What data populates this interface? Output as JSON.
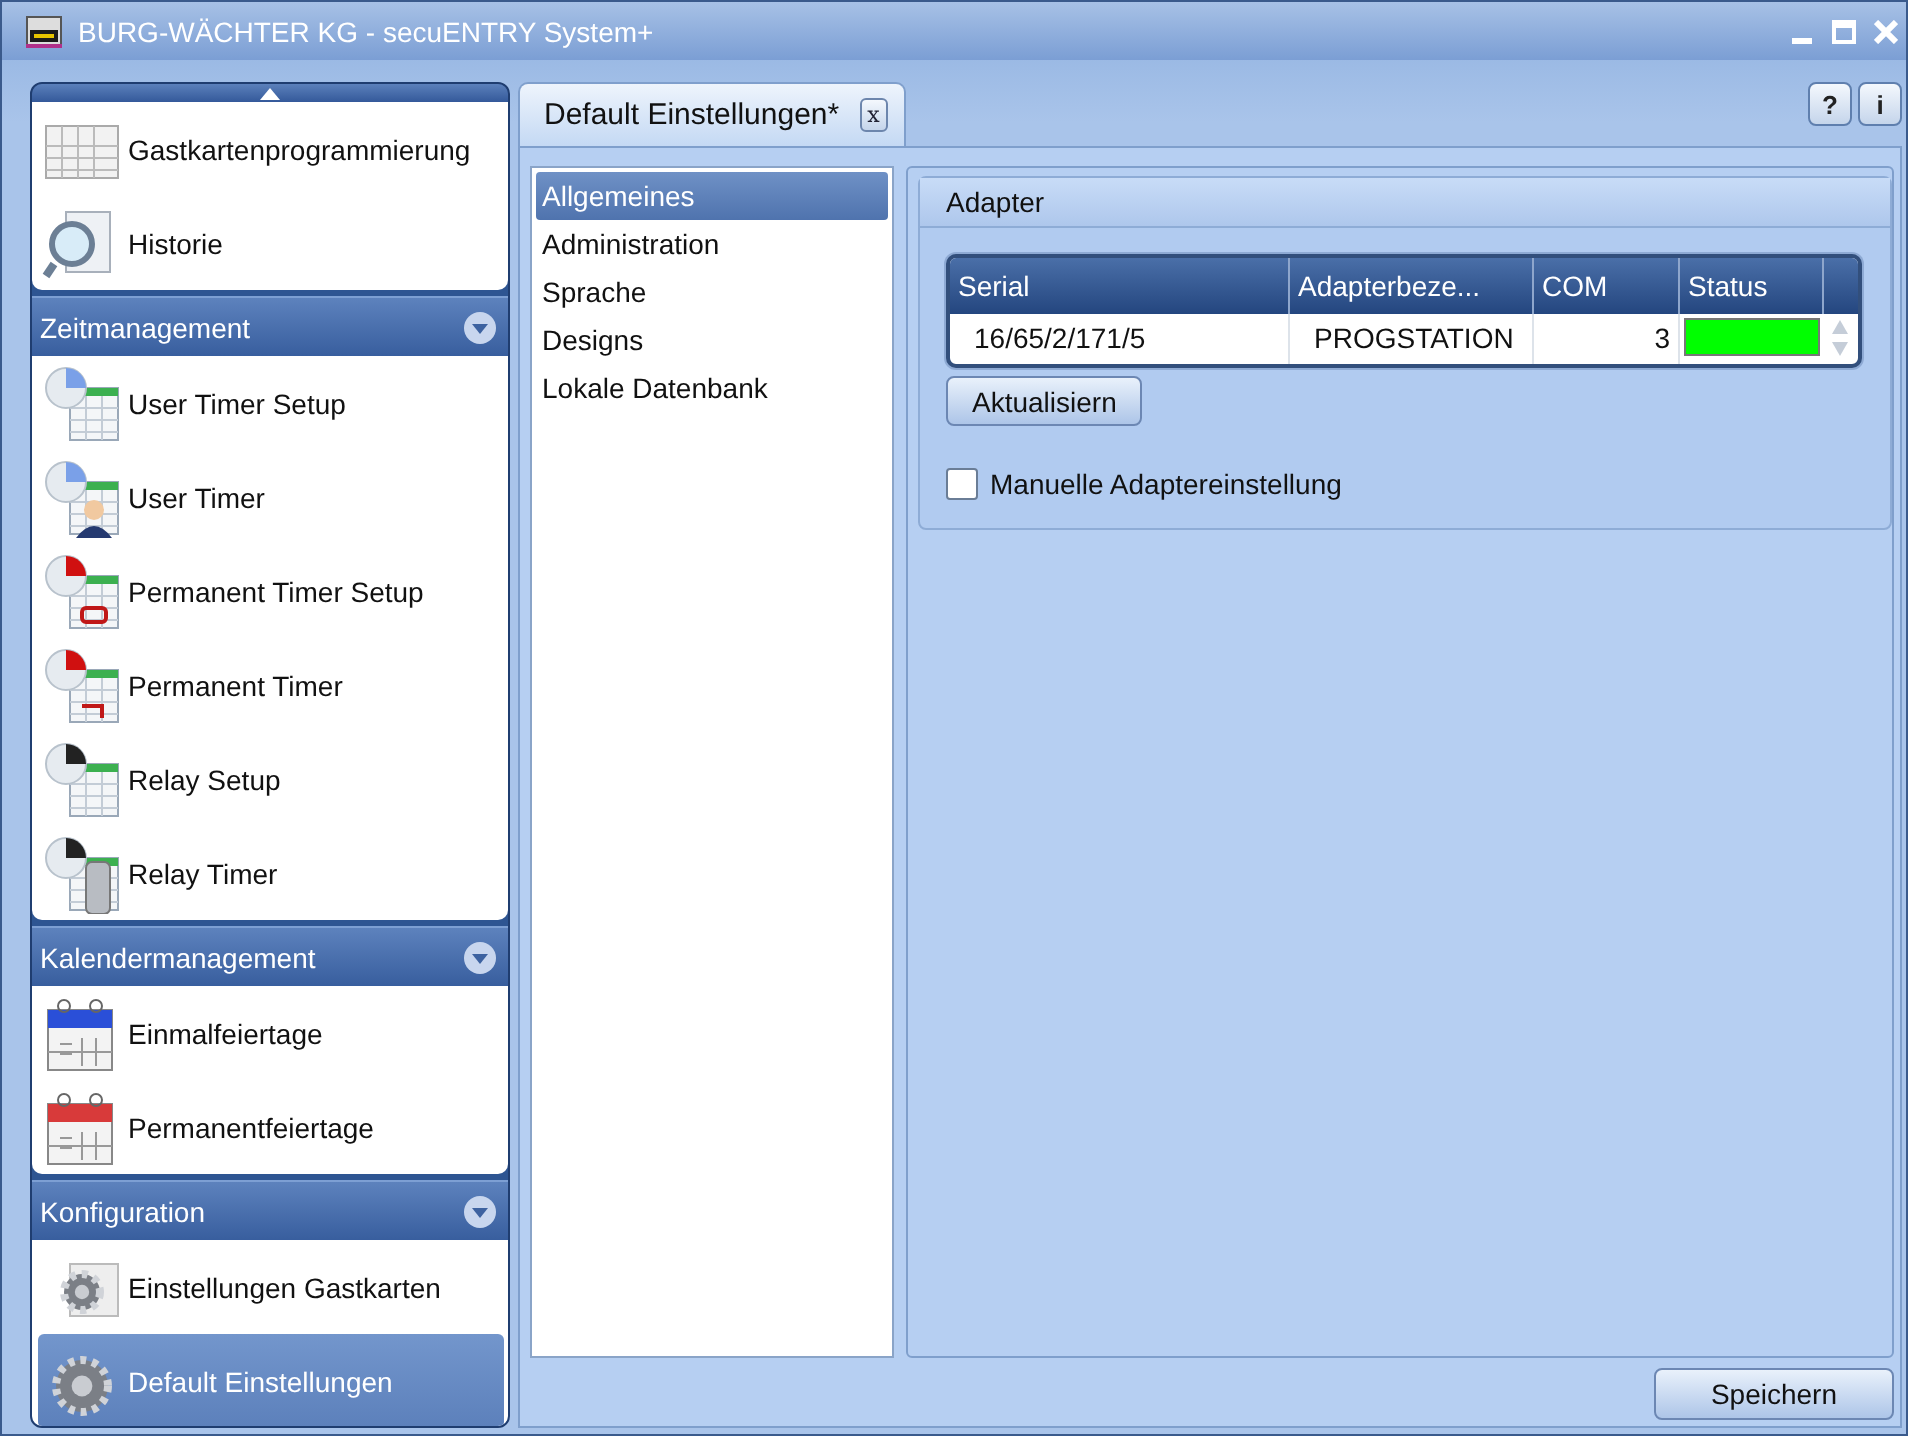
{
  "window": {
    "title": "BURG-WÄCHTER KG - secuENTRY System+"
  },
  "sidebar": {
    "groups": [
      {
        "items": [
          {
            "label": "Gastkartenprogrammierung",
            "kind": "guest-card",
            "selected": false
          },
          {
            "label": "Historie",
            "kind": "history",
            "selected": false
          }
        ]
      },
      {
        "title": "Zeitmanagement",
        "items": [
          {
            "label": "User Timer Setup",
            "kind": "user-timer-setup",
            "selected": false
          },
          {
            "label": "User Timer",
            "kind": "user-timer",
            "selected": false
          },
          {
            "label": "Permanent Timer Setup",
            "kind": "permanent-timer-setup",
            "selected": false
          },
          {
            "label": "Permanent Timer",
            "kind": "permanent-timer",
            "selected": false
          },
          {
            "label": "Relay Setup",
            "kind": "relay-setup",
            "selected": false
          },
          {
            "label": "Relay Timer",
            "kind": "relay-timer",
            "selected": false
          }
        ]
      },
      {
        "title": "Kalendermanagement",
        "items": [
          {
            "label": "Einmalfeiertage",
            "kind": "single-holiday",
            "selected": false
          },
          {
            "label": "Permanentfeiertage",
            "kind": "permanent-holiday",
            "selected": false
          }
        ]
      },
      {
        "title": "Konfiguration",
        "items": [
          {
            "label": "Einstellungen Gastkarten",
            "kind": "guest-card-settings",
            "selected": false
          },
          {
            "label": "Default Einstellungen",
            "kind": "default-settings",
            "selected": true
          }
        ]
      }
    ]
  },
  "tabs": [
    {
      "label": "Default Einstellungen*",
      "close": "x",
      "selected": true
    }
  ],
  "help_buttons": [
    "?",
    "i"
  ],
  "settings_list": [
    {
      "label": "Allgemeines",
      "selected": true
    },
    {
      "label": "Administration",
      "selected": false
    },
    {
      "label": "Sprache",
      "selected": false
    },
    {
      "label": "Designs",
      "selected": false
    },
    {
      "label": "Lokale Datenbank",
      "selected": false
    }
  ],
  "adapter": {
    "title": "Adapter",
    "table": {
      "columns": [
        "Serial",
        "Adapterbeze...",
        "COM",
        "Status"
      ],
      "rows": [
        {
          "serial": "16/65/2/171/5",
          "name": "PROGSTATION",
          "com": "3",
          "color": "#00ff00"
        }
      ]
    },
    "refresh_button": "Aktualisiern",
    "manual_checkbox": {
      "label": "Manuelle Adaptereinstellung",
      "checked": false
    }
  },
  "save_button": "Speichern"
}
